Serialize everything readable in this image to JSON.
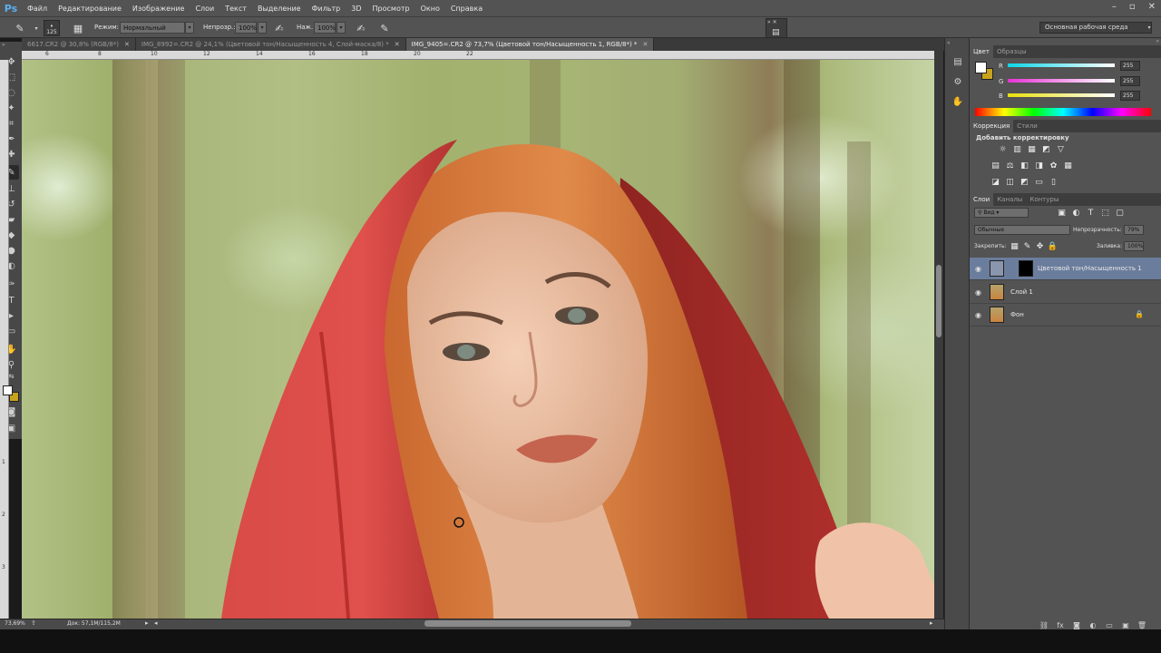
{
  "app": {
    "logo": "Ps"
  },
  "menu": [
    "Файл",
    "Редактирование",
    "Изображение",
    "Слои",
    "Текст",
    "Выделение",
    "Фильтр",
    "3D",
    "Просмотр",
    "Окно",
    "Справка"
  ],
  "options": {
    "brush_size": "125",
    "mode_label": "Режим:",
    "mode_value": "Нормальный",
    "opacity_label": "Непрозр.:",
    "opacity_value": "100%",
    "flow_label": "Наж.:",
    "flow_value": "100%",
    "workspace": "Основная рабочая среда"
  },
  "tabs": [
    {
      "label": "6617.CR2 @ 30,8% (RGB/8*)",
      "active": false
    },
    {
      "label": "IMG_8992=.CR2 @ 24,1% (Цветовой тон/Насыщенность 4, Слой-маска/8) *",
      "active": false
    },
    {
      "label": "IMG_9405=.CR2 @ 73,7% (Цветовой тон/Насыщенность 1, RGB/8*) *",
      "active": true
    }
  ],
  "ruler_h": [
    "6",
    "8",
    "10",
    "12",
    "14",
    "16",
    "18",
    "20",
    "22"
  ],
  "ruler_v": [
    "1",
    "2",
    "3"
  ],
  "status": {
    "zoom": "73,69%",
    "doc": "Док: 57,1M/115,2M"
  },
  "color_panel": {
    "tabs": [
      "Цвет",
      "Образцы"
    ],
    "channels": [
      {
        "name": "R",
        "value": "255",
        "color": "#33d6e8"
      },
      {
        "name": "G",
        "value": "255",
        "color": "#e85ad6"
      },
      {
        "name": "B",
        "value": "255",
        "color": "#e8e02a"
      }
    ],
    "fg": "#ffffff",
    "bg": "#c8a21e"
  },
  "adjust_panel": {
    "tabs": [
      "Коррекция",
      "Стили"
    ],
    "heading": "Добавить корректировку"
  },
  "layers_panel": {
    "tabs": [
      "Слои",
      "Каналы",
      "Контуры"
    ],
    "filter": "Вид",
    "blend": "Обычные",
    "opacity_label": "Непрозрачность:",
    "opacity": "79%",
    "lock_label": "Закрепить:",
    "fill_label": "Заливка:",
    "fill": "100%",
    "layers": [
      {
        "name": "Цветовой тон/Насыщенность 1",
        "selected": true
      },
      {
        "name": "Слой 1",
        "selected": false
      },
      {
        "name": "Фон",
        "selected": false
      }
    ]
  },
  "icons": {
    "close": "close-icon",
    "minimize": "minimize-icon",
    "maximize": "maximize-icon"
  }
}
